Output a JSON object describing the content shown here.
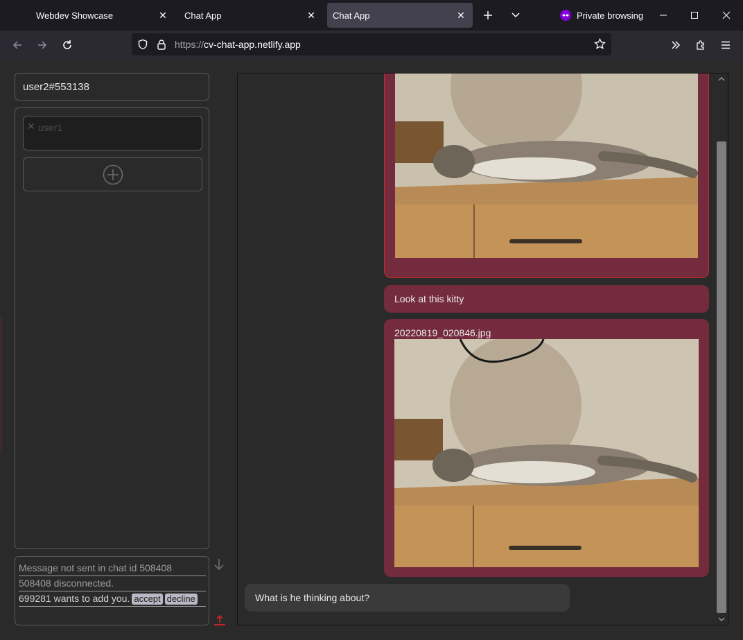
{
  "browser": {
    "tabs": [
      {
        "title": "Webdev Showcase",
        "active": false
      },
      {
        "title": "Chat App",
        "active": false
      },
      {
        "title": "Chat App",
        "active": true
      }
    ],
    "private_label": "Private browsing",
    "url_scheme": "https://",
    "url_host": "cv-chat-app.netlify.app"
  },
  "sidebar": {
    "username": "user2#553138",
    "chats": [
      {
        "name": "user1"
      }
    ]
  },
  "notifications": {
    "lines": [
      "Message not sent in chat id 508408",
      "508408 disconnected."
    ],
    "request": {
      "text": "699281 wants to add you.",
      "accept_label": "accept",
      "decline_label": "decline"
    }
  },
  "messages": [
    {
      "type": "image",
      "direction": "out",
      "filename": ""
    },
    {
      "type": "text",
      "direction": "out",
      "text": "Look at this kitty"
    },
    {
      "type": "image",
      "direction": "out",
      "filename": "20220819_020846.jpg"
    },
    {
      "type": "text",
      "direction": "in",
      "text": "What is he thinking about?"
    }
  ],
  "colors": {
    "outgoing_bubble": "#742b3e",
    "incoming_bubble": "#3a3a3a",
    "page_bg": "#2a2a2a",
    "upload_icon": "#d42525"
  },
  "icons": [
    "close-icon",
    "plus-icon",
    "chevron-down-icon",
    "back-icon",
    "forward-icon",
    "reload-icon",
    "shield-icon",
    "lock-icon",
    "star-icon",
    "extensions-overflow-icon",
    "puzzle-icon",
    "menu-icon",
    "add-circle-icon",
    "arrow-down-icon",
    "upload-icon"
  ]
}
